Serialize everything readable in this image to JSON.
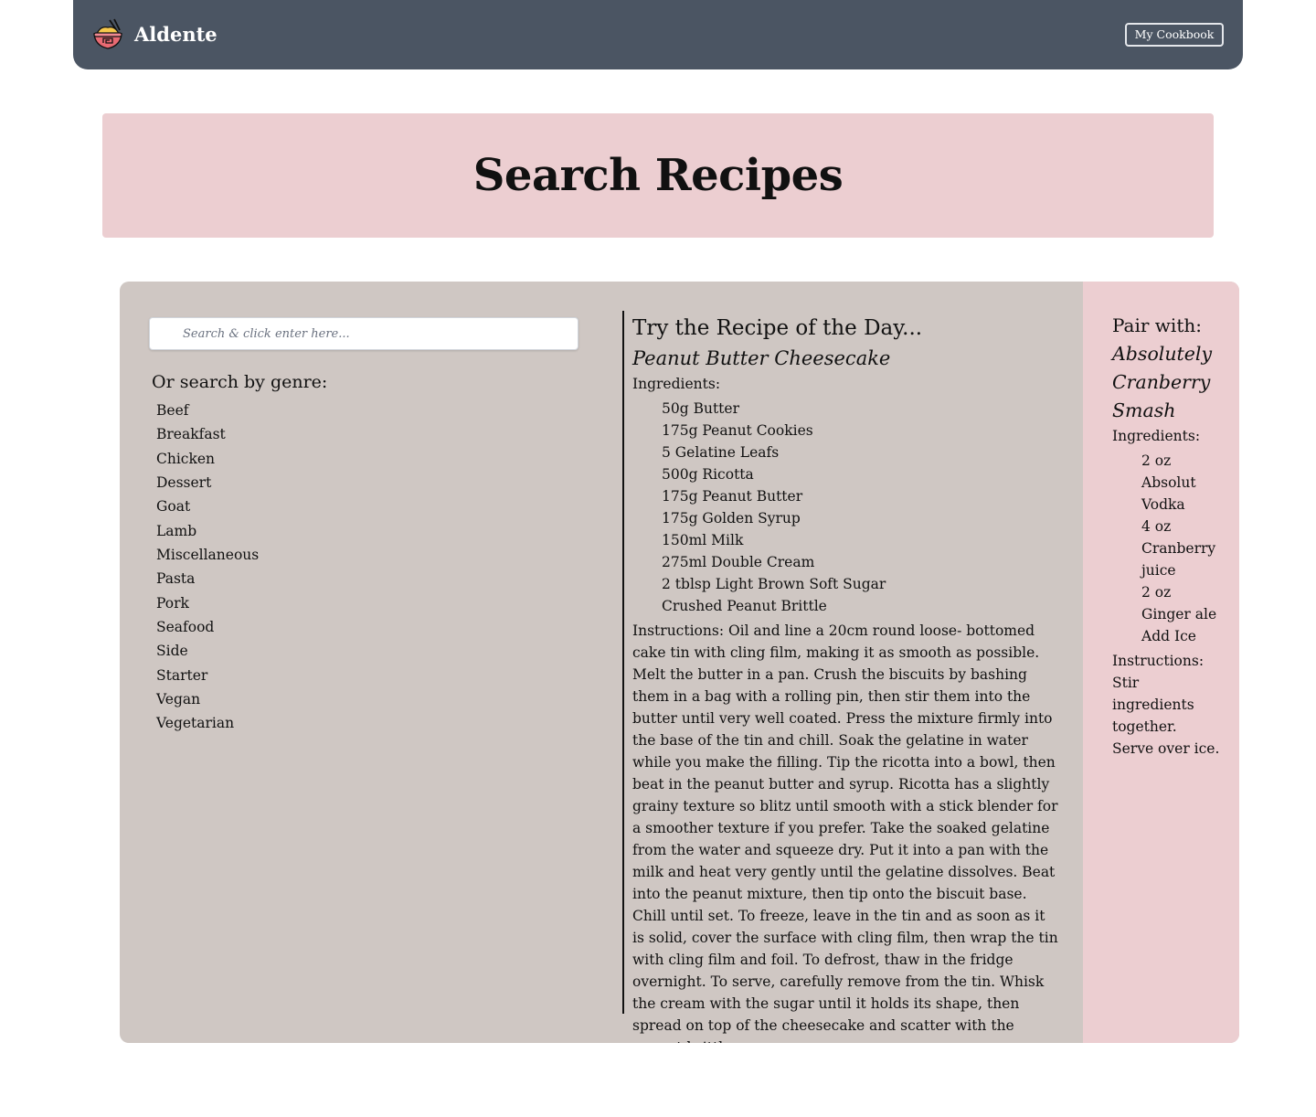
{
  "nav": {
    "brand": "Aldente",
    "logo_icon": "noodle-bowl-icon",
    "cookbook_button": "My Cookbook",
    "background": "#4b5563"
  },
  "hero": {
    "title": "Search Recipes",
    "background": "#ecced1"
  },
  "search": {
    "placeholder": "Search & click enter here...",
    "icon": "search-icon"
  },
  "genres": {
    "heading": "Or search by genre:",
    "items": [
      "Beef",
      "Breakfast",
      "Chicken",
      "Dessert",
      "Goat",
      "Lamb",
      "Miscellaneous",
      "Pasta",
      "Pork",
      "Seafood",
      "Side",
      "Starter",
      "Vegan",
      "Vegetarian"
    ]
  },
  "recipe_of_day": {
    "heading": "Try the Recipe of the Day...",
    "name": "Peanut Butter Cheesecake",
    "ingredients_label": "Ingredients:",
    "ingredients": [
      "50g Butter",
      "175g Peanut Cookies",
      "5 Gelatine Leafs",
      "500g Ricotta",
      "175g Peanut Butter",
      "175g Golden Syrup",
      "150ml Milk",
      "275ml Double Cream",
      "2 tblsp Light Brown Soft Sugar",
      "Crushed Peanut Brittle"
    ],
    "instructions": "Instructions: Oil and line a 20cm round loose- bottomed cake tin with cling film, making it as smooth as possible. Melt the butter in a pan. Crush the biscuits by bashing them in a bag with a rolling pin, then stir them into the butter until very well coated. Press the mixture firmly into the base of the tin and chill. Soak the gelatine in water while you make the filling. Tip the ricotta into a bowl, then beat in the peanut butter and syrup. Ricotta has a slightly grainy texture so blitz until smooth with a stick blender for a smoother texture if you prefer. Take the soaked gelatine from the water and squeeze dry. Put it into a pan with the milk and heat very gently until the gelatine dissolves. Beat into the peanut mixture, then tip onto the biscuit base. Chill until set. To freeze, leave in the tin and as soon as it is solid, cover the surface with cling film, then wrap the tin with cling film and foil. To defrost, thaw in the fridge overnight. To serve, carefully remove from the tin. Whisk the cream with the sugar until it holds its shape, then spread on top of the cheesecake and scatter with the peanut brittle."
  },
  "pairing": {
    "heading": "Pair with:",
    "name": "Absolutely Cranberry Smash",
    "ingredients_label": "Ingredients:",
    "ingredients": [
      "2 oz Absolut Vodka",
      "4 oz Cranberry juice",
      "2 oz Ginger ale",
      "Add Ice"
    ],
    "instructions": "Instructions: Stir ingredients together. Serve over ice."
  },
  "colors": {
    "panel": "#cfc7c3",
    "accent_pink": "#ecced1"
  }
}
